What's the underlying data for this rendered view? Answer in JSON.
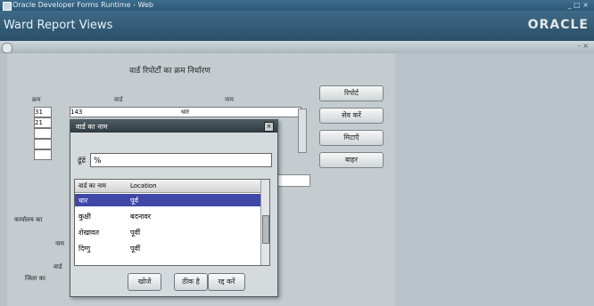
{
  "window": {
    "title": "Oracle Developer Forms Runtime - Web",
    "controls": "_ □ ×"
  },
  "app": {
    "title": "Ward Report Views",
    "brand": "ORACLE"
  },
  "subbar": {
    "right": "- ×"
  },
  "form": {
    "heading": "वार्ड रिपोर्टों का क्रम निर्धारण",
    "col_seq": "क्रम",
    "col_ward": "वार्ड",
    "col_name": "नाम",
    "rows": [
      {
        "seq": "31",
        "ward": "143",
        "name": "धार"
      },
      {
        "seq": "21",
        "ward": "",
        "name": ""
      },
      {
        "seq": "",
        "ward": "",
        "name": ""
      },
      {
        "seq": "",
        "ward": "",
        "name": ""
      },
      {
        "seq": "",
        "ward": "",
        "name": ""
      }
    ],
    "side_labels": [
      "कार्यालय का",
      "नाम",
      "वार्ड",
      "जिला का"
    ]
  },
  "buttons": [
    "रिपोर्ट",
    "सेव करें",
    "मिटाएँ",
    "बाहर"
  ],
  "dialog": {
    "title": "वार्ड का नाम",
    "find_label": "ढूँढें",
    "find_value": "%",
    "headers": [
      "वार्ड का नाम",
      "Location"
    ],
    "rows": [
      {
        "name": "धार",
        "loc": "पूर्व"
      },
      {
        "name": "कुक्षी",
        "loc": "बदनावर"
      },
      {
        "name": "शेखावत",
        "loc": "पूर्वी"
      },
      {
        "name": "दिग्गु",
        "loc": "पूर्वी"
      }
    ],
    "buttons": {
      "find": "खोजें",
      "ok": "ठीक है",
      "cancel": "रद्द करें"
    }
  }
}
